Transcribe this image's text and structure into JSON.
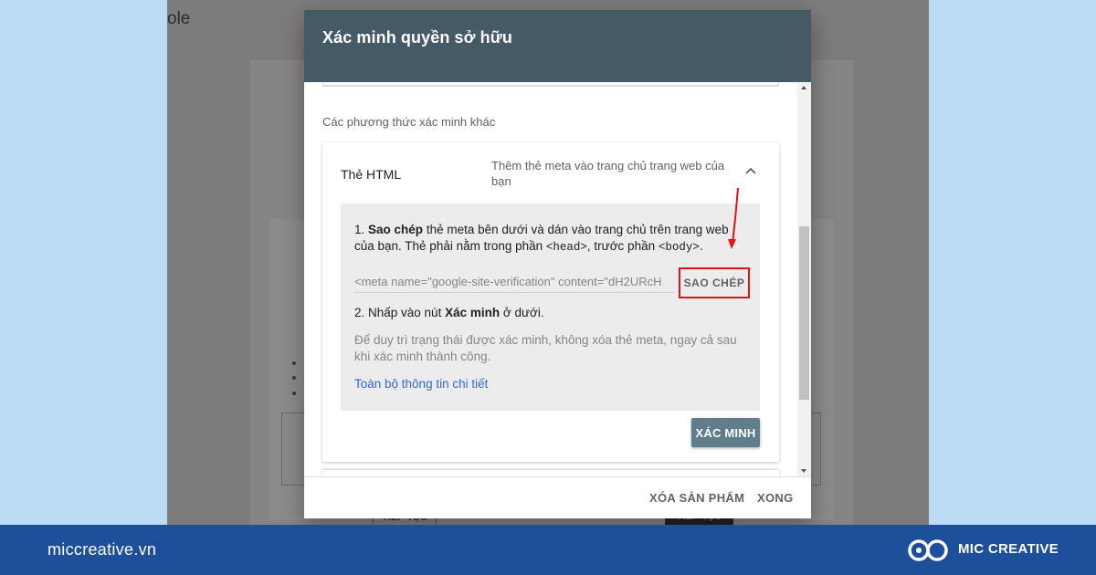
{
  "background": {
    "title_fragment": "ole",
    "button_left": "TIẾP TỤC",
    "button_right": "TIẾP TỤC"
  },
  "dialog": {
    "title": "Xác minh quyền sở hữu",
    "section_label": "Các phương thức xác minh khác",
    "method": {
      "name": "Thẻ HTML",
      "description": "Thêm thẻ meta vào trang chủ trang web của bạn"
    },
    "step1": {
      "number": "1.",
      "bold": "Sao chép",
      "text_a": " thẻ meta bên dưới và dán vào trang chủ trên trang web của bạn. Thẻ phải nằm trong phần ",
      "code_head": "<head>",
      "text_b": ", trước phần ",
      "code_body": "<body>",
      "text_c": "."
    },
    "meta_tag": "<meta name=\"google-site-verification\" content=\"dH2URcH",
    "copy_button": "SAO CHÉP",
    "step2": {
      "text_a": "2. Nhấp vào nút ",
      "bold": "Xác minh",
      "text_b": " ở dưới."
    },
    "note": "Để duy trì trạng thái được xác minh, không xóa thẻ meta, ngay cả sau khi xác minh thành công.",
    "details_link": "Toàn bộ thông tin chi tiết",
    "verify_button": "XÁC MINH",
    "footer": {
      "remove_property": "XÓA SẢN PHẨM",
      "done": "XONG"
    }
  },
  "brand": {
    "url": "miccreative.vn",
    "name": "MIC CREATIVE"
  },
  "colors": {
    "header": "#455a64",
    "verify_button": "#607d8b",
    "link": "#3367d6",
    "highlight": "#e1131b",
    "brand_bar": "#1d4f9a"
  }
}
